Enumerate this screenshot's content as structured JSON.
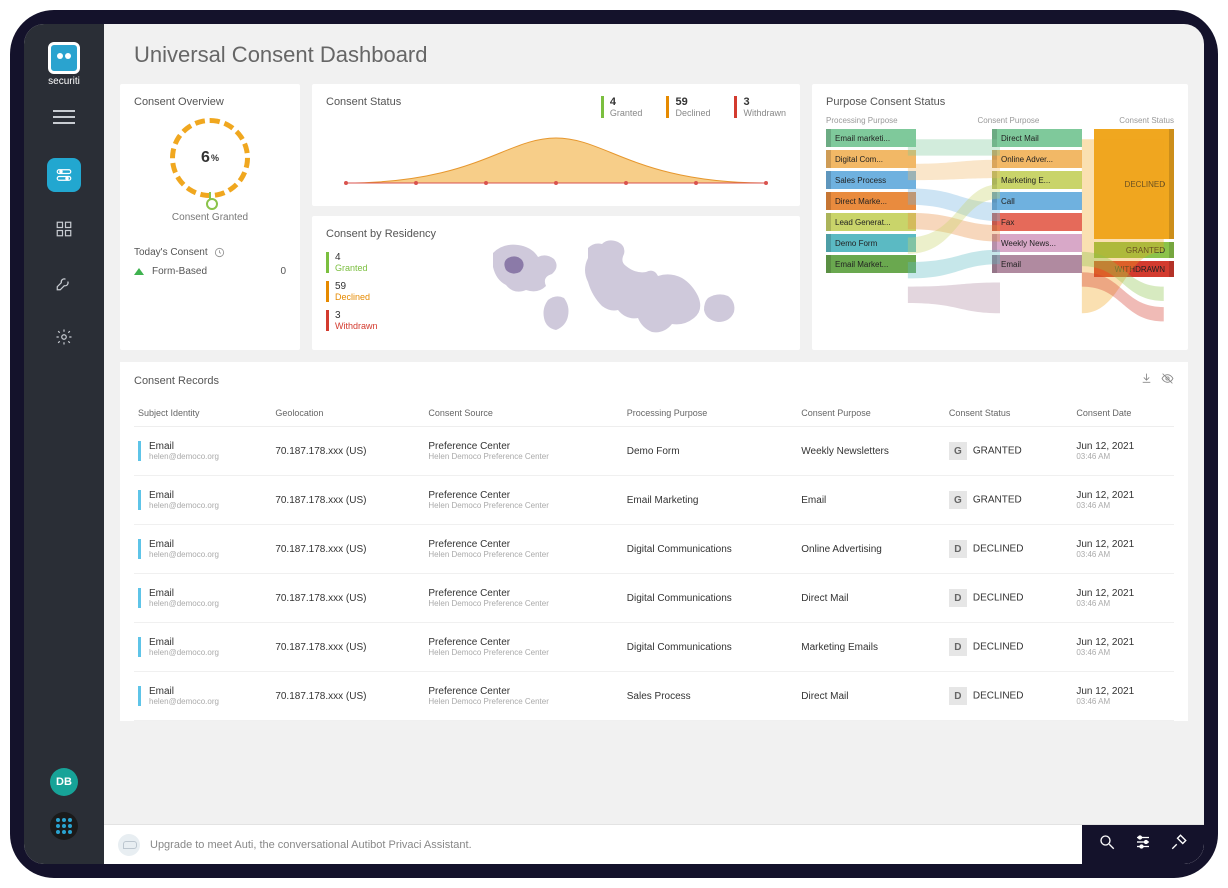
{
  "brand": "securiti",
  "page_title": "Universal Consent Dashboard",
  "sidebar": {
    "hamburger": "menu-icon",
    "items": [
      {
        "name": "toggles",
        "active": true
      },
      {
        "name": "dashboard",
        "active": false
      },
      {
        "name": "settings-wrench",
        "active": false
      },
      {
        "name": "settings-gear",
        "active": false
      }
    ],
    "avatar_initials": "DB"
  },
  "overview": {
    "title": "Consent Overview",
    "gauge_value": "6",
    "gauge_unit": "%",
    "gauge_label": "Consent Granted",
    "today_title": "Today's Consent",
    "today_icon": "clock-icon",
    "form_based_label": "Form-Based",
    "form_based_value": "0"
  },
  "status_card": {
    "title": "Consent Status",
    "stats": [
      {
        "count": "4",
        "label": "Granted",
        "class": "sb-g"
      },
      {
        "count": "59",
        "label": "Declined",
        "class": "sb-d"
      },
      {
        "count": "3",
        "label": "Withdrawn",
        "class": "sb-w"
      }
    ]
  },
  "residency": {
    "title": "Consent by Residency",
    "stats": [
      {
        "count": "4",
        "label": "Granted",
        "class": "g"
      },
      {
        "count": "59",
        "label": "Declined",
        "class": "d"
      },
      {
        "count": "3",
        "label": "Withdrawn",
        "class": "w"
      }
    ]
  },
  "sankey": {
    "title": "Purpose Consent Status",
    "col_heads": [
      "Processing Purpose",
      "Consent Purpose",
      "Consent Status"
    ],
    "col1": [
      {
        "label": "Email marketi...",
        "color": "#7fc99b"
      },
      {
        "label": "Digital Com...",
        "color": "#f2b866"
      },
      {
        "label": "Sales Process",
        "color": "#6fb1df"
      },
      {
        "label": "Direct Marke...",
        "color": "#e98b3e"
      },
      {
        "label": "Lead Generat...",
        "color": "#c9d46a"
      },
      {
        "label": "Demo Form",
        "color": "#5bbac3"
      },
      {
        "label": "Email Market...",
        "color": "#6aa84f"
      }
    ],
    "col2": [
      {
        "label": "Direct Mail",
        "color": "#7fc99b"
      },
      {
        "label": "Online Adver...",
        "color": "#f2b866"
      },
      {
        "label": "Marketing E...",
        "color": "#c9d46a"
      },
      {
        "label": "Call",
        "color": "#6fb1df"
      },
      {
        "label": "Fax",
        "color": "#e56a5a"
      },
      {
        "label": "Weekly News...",
        "color": "#d8a8c8"
      },
      {
        "label": "Email",
        "color": "#b08aa0"
      }
    ],
    "col3": [
      {
        "label": "DECLINED",
        "color": "#f0a71f",
        "h": 110
      },
      {
        "label": "GRANTED",
        "color": "#8bc34a",
        "h": 16
      },
      {
        "label": "WITHDRAWN",
        "color": "#d33b2f",
        "h": 16
      }
    ]
  },
  "records": {
    "title": "Consent Records",
    "columns": [
      "Subject Identity",
      "Geolocation",
      "Consent Source",
      "Processing Purpose",
      "Consent Purpose",
      "Consent Status",
      "Consent Date"
    ],
    "rows": [
      {
        "id_primary": "Email",
        "id_secondary": "helen@democo.org",
        "geo": "70.187.178.xxx (US)",
        "src_primary": "Preference Center",
        "src_secondary": "Helen Democo Preference Center",
        "purpose": "Demo Form",
        "cpurpose": "Weekly Newsletters",
        "status_badge": "G",
        "status": "GRANTED",
        "date": "Jun 12, 2021",
        "time": "03:46 AM"
      },
      {
        "id_primary": "Email",
        "id_secondary": "helen@democo.org",
        "geo": "70.187.178.xxx (US)",
        "src_primary": "Preference Center",
        "src_secondary": "Helen Democo Preference Center",
        "purpose": "Email Marketing",
        "cpurpose": "Email",
        "status_badge": "G",
        "status": "GRANTED",
        "date": "Jun 12, 2021",
        "time": "03:46 AM"
      },
      {
        "id_primary": "Email",
        "id_secondary": "helen@democo.org",
        "geo": "70.187.178.xxx (US)",
        "src_primary": "Preference Center",
        "src_secondary": "Helen Democo Preference Center",
        "purpose": "Digital Communications",
        "cpurpose": "Online Advertising",
        "status_badge": "D",
        "status": "DECLINED",
        "date": "Jun 12, 2021",
        "time": "03:46 AM"
      },
      {
        "id_primary": "Email",
        "id_secondary": "helen@democo.org",
        "geo": "70.187.178.xxx (US)",
        "src_primary": "Preference Center",
        "src_secondary": "Helen Democo Preference Center",
        "purpose": "Digital Communications",
        "cpurpose": "Direct Mail",
        "status_badge": "D",
        "status": "DECLINED",
        "date": "Jun 12, 2021",
        "time": "03:46 AM"
      },
      {
        "id_primary": "Email",
        "id_secondary": "helen@democo.org",
        "geo": "70.187.178.xxx (US)",
        "src_primary": "Preference Center",
        "src_secondary": "Helen Democo Preference Center",
        "purpose": "Digital Communications",
        "cpurpose": "Marketing Emails",
        "status_badge": "D",
        "status": "DECLINED",
        "date": "Jun 12, 2021",
        "time": "03:46 AM"
      },
      {
        "id_primary": "Email",
        "id_secondary": "helen@democo.org",
        "geo": "70.187.178.xxx (US)",
        "src_primary": "Preference Center",
        "src_secondary": "Helen Democo Preference Center",
        "purpose": "Sales Process",
        "cpurpose": "Direct Mail",
        "status_badge": "D",
        "status": "DECLINED",
        "date": "Jun 12, 2021",
        "time": "03:46 AM"
      }
    ]
  },
  "footer": {
    "text": "Upgrade to meet Auti, the conversational Autibot Privaci Assistant."
  }
}
